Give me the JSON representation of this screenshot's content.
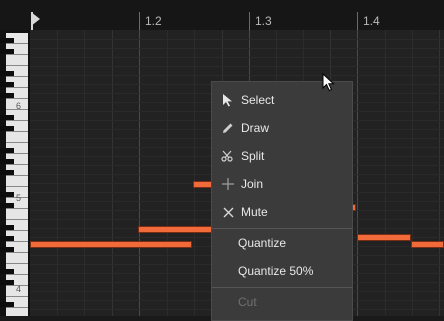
{
  "ruler": {
    "markers": [
      {
        "label": "1.2"
      },
      {
        "label": "1.3"
      },
      {
        "label": "1.4"
      }
    ]
  },
  "piano": {
    "octave_labels": [
      "6",
      "5",
      "4"
    ]
  },
  "context_menu": {
    "items": [
      {
        "label": "Select",
        "icon": "pointer-icon"
      },
      {
        "label": "Draw",
        "icon": "pencil-icon"
      },
      {
        "label": "Split",
        "icon": "scissors-icon"
      },
      {
        "label": "Join",
        "icon": "plus-icon"
      },
      {
        "label": "Mute",
        "icon": "x-icon"
      },
      {
        "label": "Quantize"
      },
      {
        "label": "Quantize 50%"
      },
      {
        "label": "Cut",
        "disabled": true
      }
    ]
  },
  "colors": {
    "note": "#f06a3a",
    "menu_bg": "#3b3b3b"
  }
}
